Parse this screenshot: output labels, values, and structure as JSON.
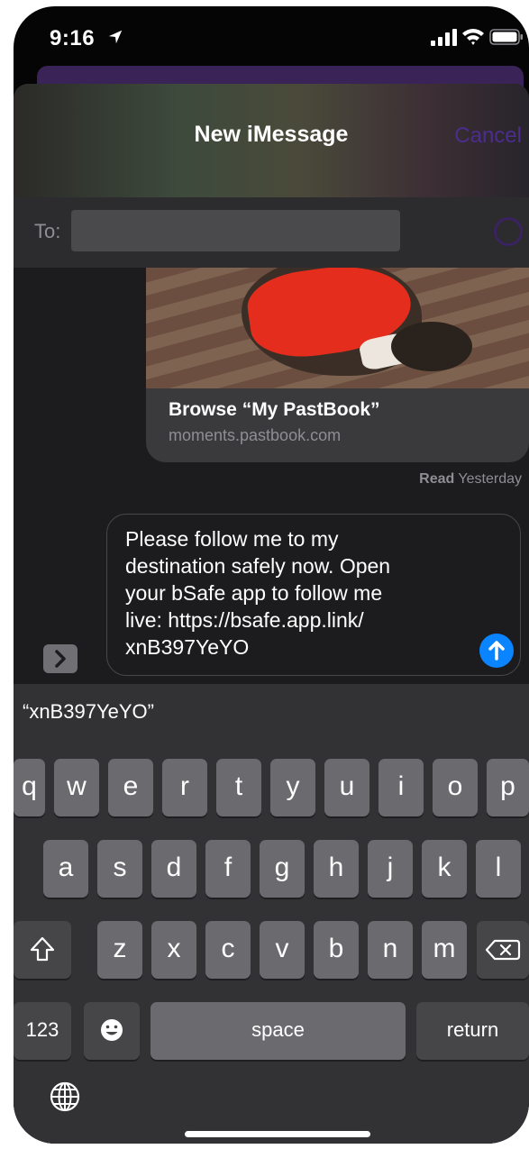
{
  "status_bar": {
    "time": "9:16"
  },
  "header": {
    "title": "New iMessage",
    "cancel_label": "Cancel"
  },
  "to_field": {
    "label": "To:"
  },
  "link_preview": {
    "title": "Browse “My PastBook”",
    "url": "moments.pastbook.com"
  },
  "read_receipt": {
    "status": "Read",
    "when": "Yesterday"
  },
  "compose": {
    "text": "Please follow me to my\ndestination safely now. Open\nyour bSafe app to follow me\nlive: https://bsafe.app.link/\nxnB397YeYO"
  },
  "suggestion": {
    "text": "“xnB397YeYO”"
  },
  "keyboard": {
    "row1": [
      "q",
      "w",
      "e",
      "r",
      "t",
      "y",
      "u",
      "i",
      "o",
      "p"
    ],
    "row2": [
      "a",
      "s",
      "d",
      "f",
      "g",
      "h",
      "j",
      "k",
      "l"
    ],
    "row3": [
      "z",
      "x",
      "c",
      "v",
      "b",
      "n",
      "m"
    ],
    "numbers_label": "123",
    "space_label": "space",
    "return_label": "return"
  },
  "icons": {
    "location": "location-arrow-icon",
    "signal": "signal-icon",
    "wifi": "wifi-icon",
    "battery": "battery-icon",
    "add_contact": "add-contact-icon",
    "expand": "chevron-right-icon",
    "send": "arrow-up-icon",
    "shift": "shift-icon",
    "delete": "backspace-icon",
    "emoji": "emoji-icon",
    "globe": "globe-icon"
  },
  "colors": {
    "accent": "#0a84ff",
    "cancel": "#4c2c8e",
    "key": "#6b6b6f",
    "key_dark": "#464649"
  }
}
